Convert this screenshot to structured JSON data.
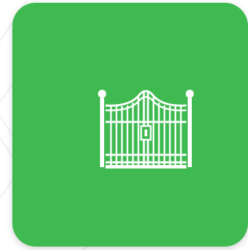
{
  "app_icon": {
    "icon_name": "gate-icon",
    "tile_color": "#3fba50",
    "icon_color": "#ffffff",
    "background_color": "#ffffff",
    "pattern_color": "#eef0f2"
  }
}
